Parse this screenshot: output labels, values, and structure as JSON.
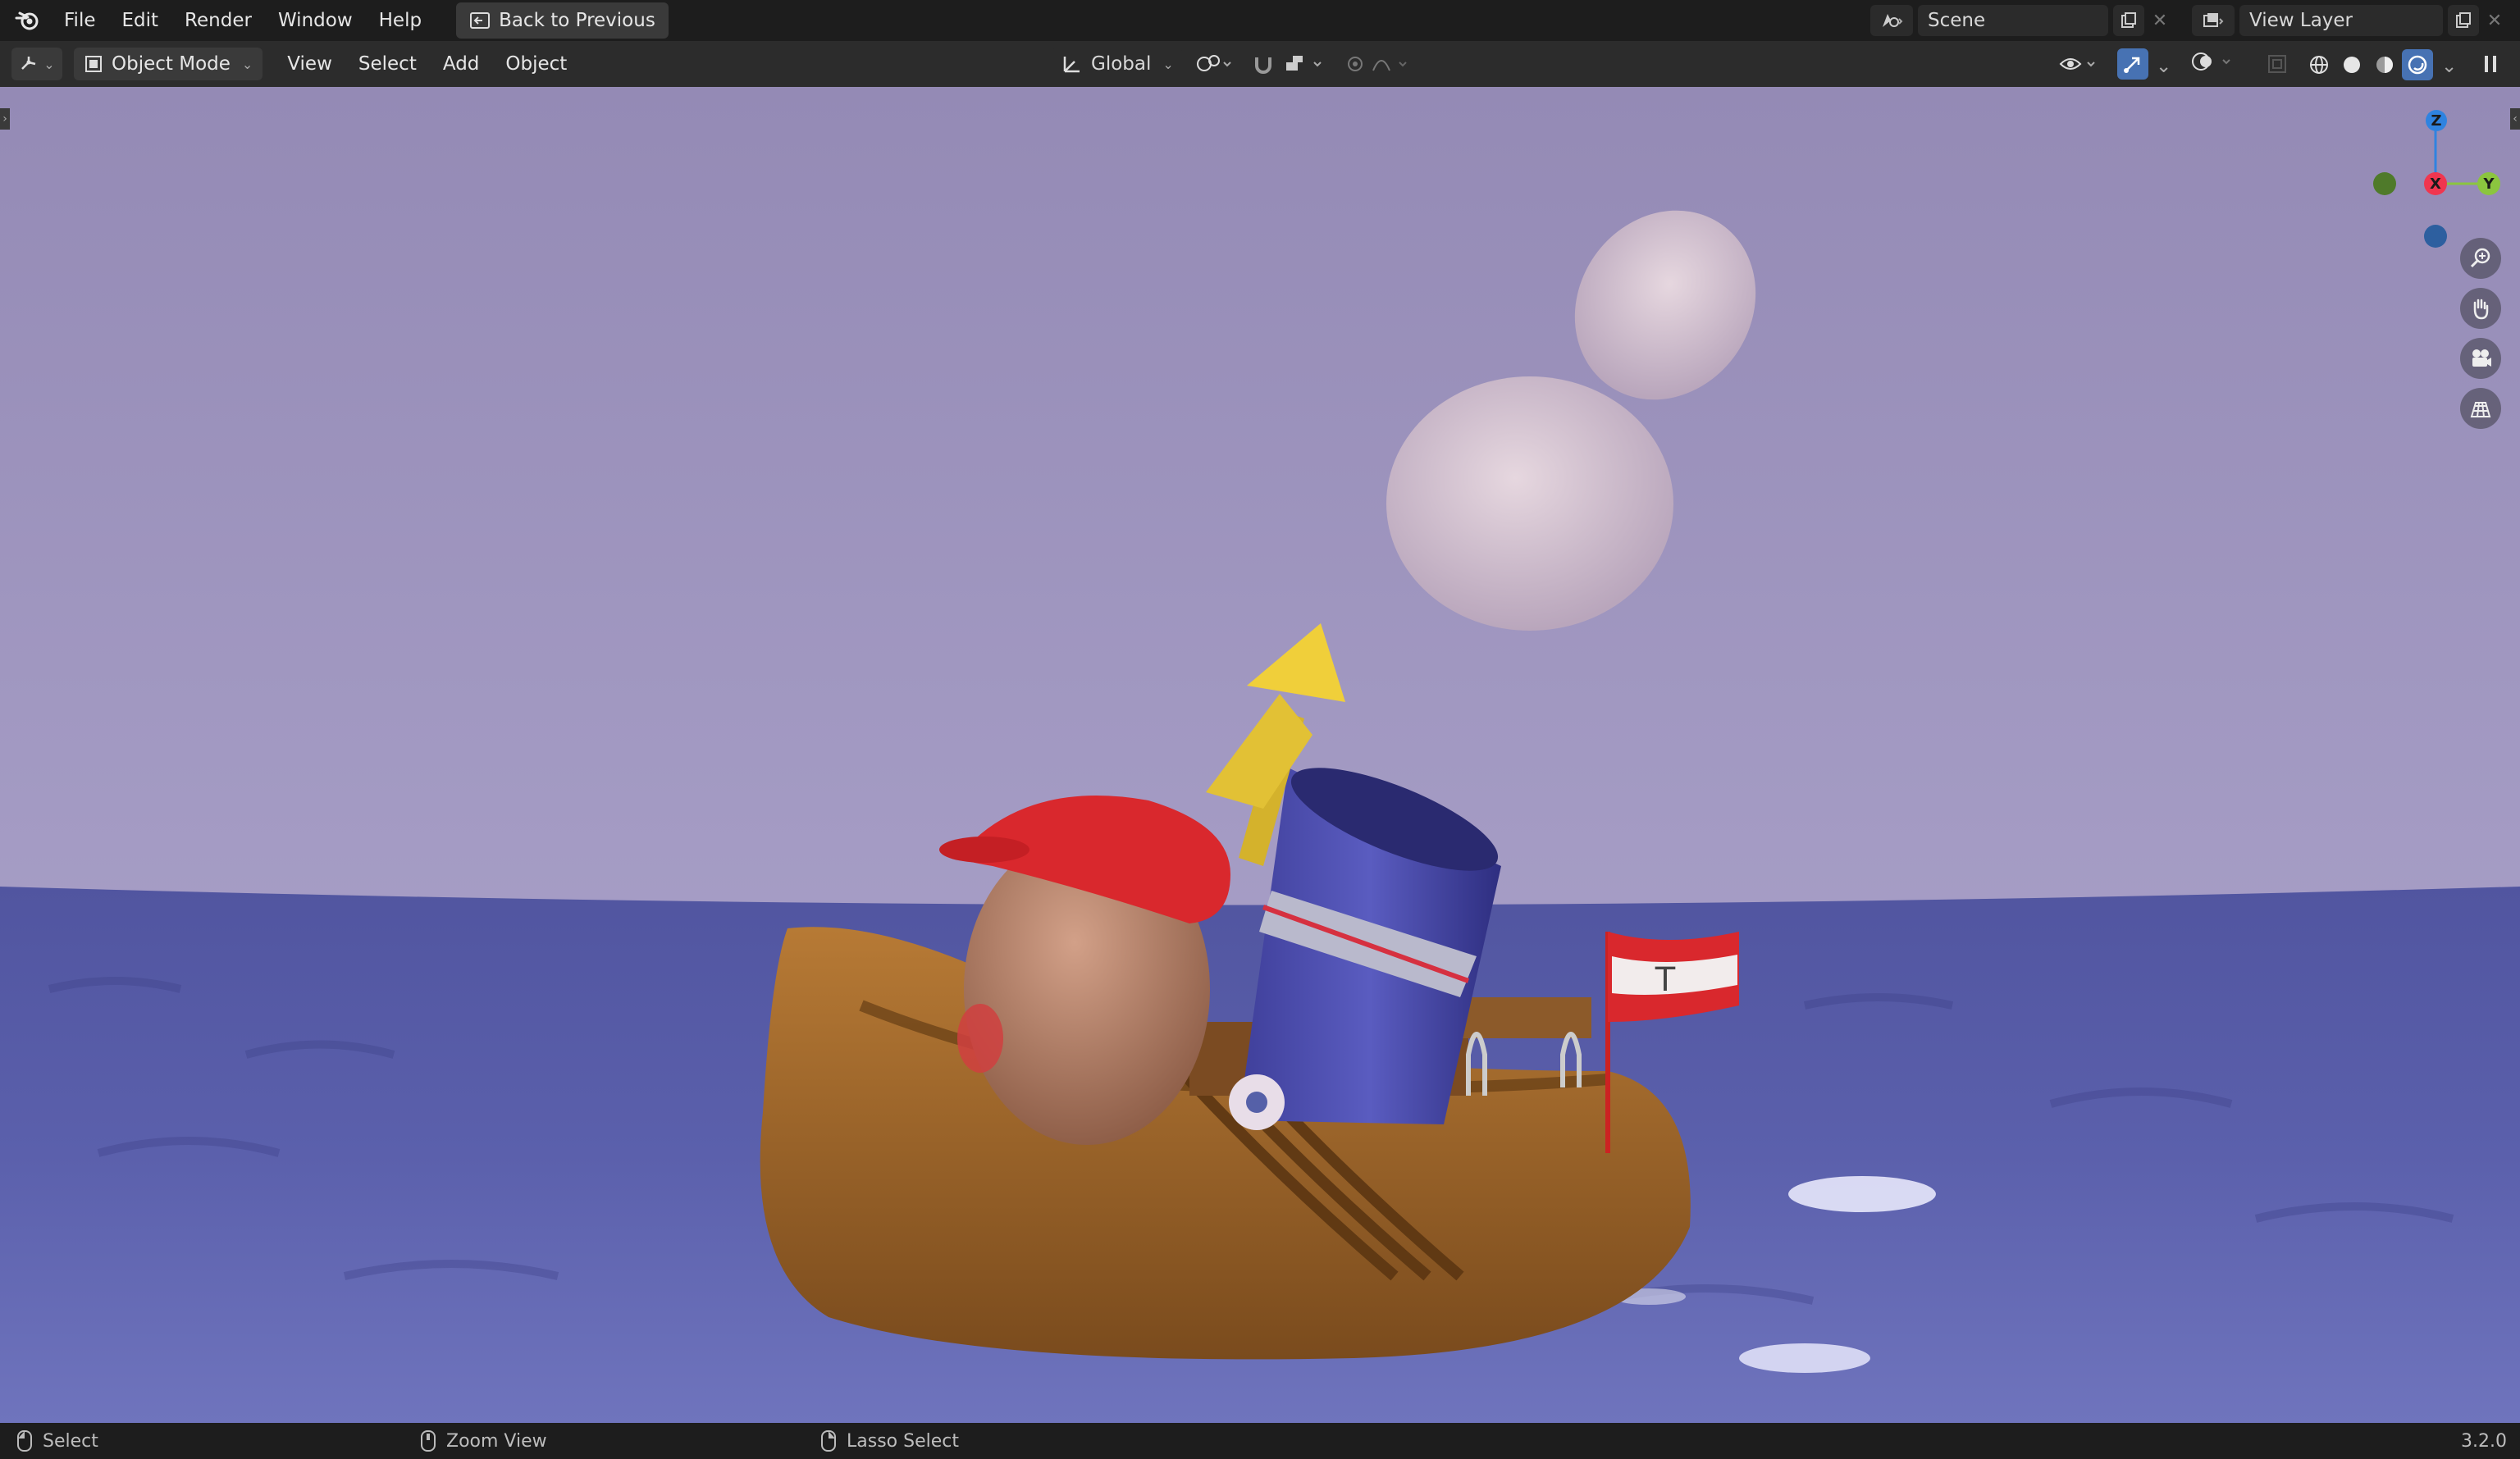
{
  "topbar": {
    "menus": [
      "File",
      "Edit",
      "Render",
      "Window",
      "Help"
    ],
    "back_button": "Back to Previous",
    "scene_name": "Scene",
    "view_layer": "View Layer"
  },
  "toolbar": {
    "mode": "Object Mode",
    "menus": [
      "View",
      "Select",
      "Add",
      "Object"
    ],
    "orientation": "Global"
  },
  "gizmo": {
    "z": "Z",
    "x": "X",
    "y": "Y",
    "colors": {
      "x": "#f0364f",
      "y": "#8bc53f",
      "z": "#2f83e0"
    }
  },
  "statusbar": {
    "left": "Select",
    "middle": "Zoom View",
    "right": "Lasso Select",
    "version": "3.2.0"
  },
  "icons": {
    "app": "blender-logo-icon",
    "back": "back-arrow-icon",
    "editor": "editor-type-icon",
    "mode": "object-mode-icon",
    "orientation": "transform-orientation-icon",
    "pivot": "pivot-icon",
    "snap": "snap-magnet-icon",
    "proportional": "proportional-edit-icon",
    "visibility": "eye-icon",
    "gizmo": "gizmo-toggle-icon",
    "overlay": "overlay-icon",
    "xray": "xray-icon",
    "shading": [
      "wireframe-shading-icon",
      "solid-shading-icon",
      "material-shading-icon",
      "rendered-shading-icon"
    ],
    "nav": [
      "zoom-icon",
      "hand-pan-icon",
      "camera-icon",
      "grid-ortho-icon"
    ]
  }
}
